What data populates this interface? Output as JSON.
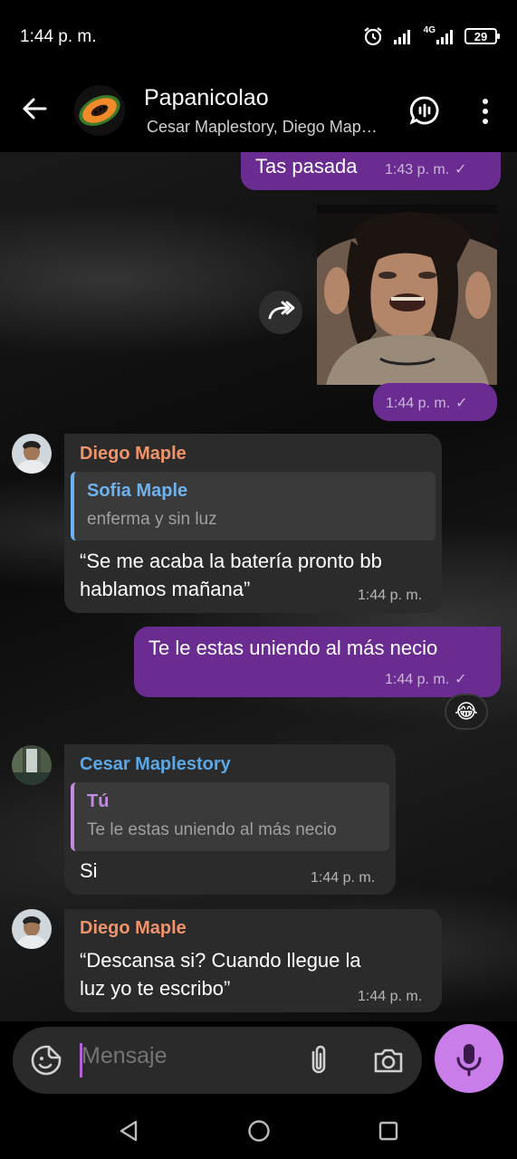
{
  "status_bar": {
    "time": "1:44 p. m.",
    "network": "4G",
    "battery": "29"
  },
  "header": {
    "title": "Papanicolao",
    "subtitle": "Cesar Maplestory, Diego Map…"
  },
  "messages": {
    "m1": {
      "text": "Tas pasada",
      "time": "1:43 p. m."
    },
    "m2": {
      "time": "1:44 p. m."
    },
    "m3": {
      "sender": "Diego Maple",
      "reply_name": "Sofia Maple",
      "reply_text": "enferma y sin luz",
      "text_line1": "“Se me acaba la batería pronto bb",
      "text_line2": "hablamos mañana”",
      "time": "1:44 p. m."
    },
    "m4": {
      "text": "Te le estas uniendo al más necio",
      "time": "1:44 p. m.",
      "reaction": "😂"
    },
    "m5": {
      "sender": "Cesar Maplestory",
      "reply_name": "Tú",
      "reply_text": "Te le estas uniendo al más necio",
      "text": "Si",
      "time": "1:44 p. m."
    },
    "m6": {
      "sender": "Diego Maple",
      "text_line1": "“Descansa si? Cuando llegue la",
      "text_line2": "luz yo te escribo”",
      "time": "1:44 p. m."
    }
  },
  "composer": {
    "placeholder": "Mensaje"
  },
  "colors": {
    "outgoing_bubble": "#6a2c91",
    "incoming_bubble": "#2b2b2b",
    "sender_diego": "#f0946b",
    "sender_cesar": "#5aa8e8",
    "reply_sofia": "#6fb3ee",
    "reply_tu": "#c28ae0",
    "mic_button": "#c97de8"
  },
  "icons": [
    "back-arrow-icon",
    "voice-chat-icon",
    "more-vert-icon",
    "forward-icon",
    "sticker-icon",
    "attach-icon",
    "camera-icon",
    "mic-icon",
    "nav-back-icon",
    "nav-home-icon",
    "nav-recents-icon"
  ]
}
